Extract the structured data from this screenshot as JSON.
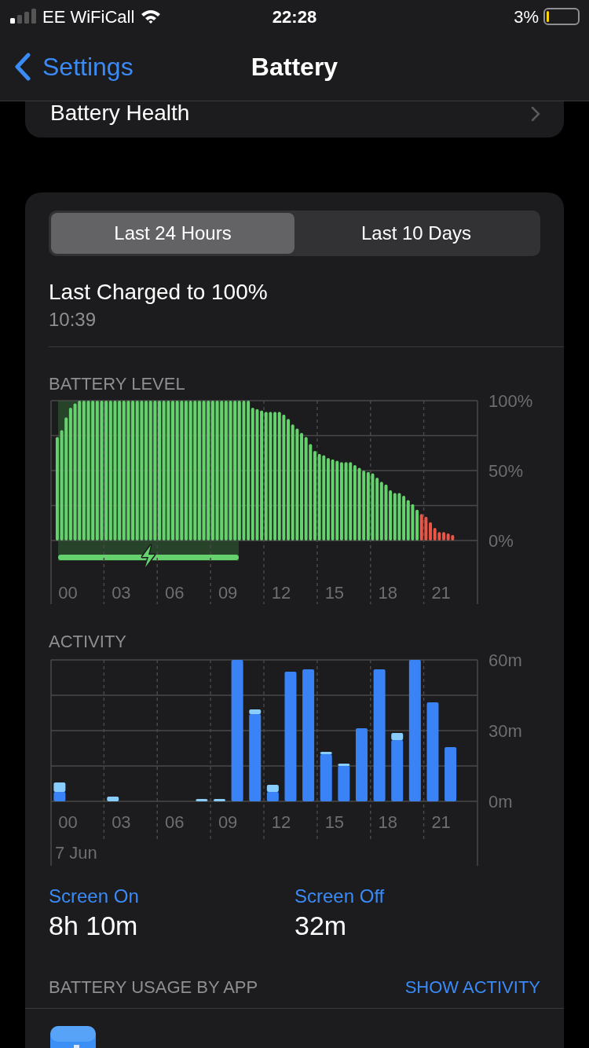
{
  "status_bar": {
    "carrier": "EE WiFiCall",
    "time": "22:28",
    "battery_percent": "3%"
  },
  "nav": {
    "back": "Settings",
    "title": "Battery"
  },
  "health_row": {
    "label": "Battery Health"
  },
  "tabs": [
    {
      "label": "Last 24 Hours",
      "selected": true
    },
    {
      "label": "Last 10 Days",
      "selected": false
    }
  ],
  "last_charged": {
    "title": "Last Charged to 100%",
    "time": "10:39"
  },
  "battery_level": {
    "label": "BATTERY LEVEL",
    "charging": true,
    "chart_data": {
      "type": "bar",
      "xlim": [
        -0.95,
        23.05
      ],
      "ylim": [
        0,
        100
      ],
      "x": [
        -0.6,
        -0.35,
        -0.1,
        0.15,
        0.4,
        0.65,
        0.9,
        1.15,
        1.4,
        1.65,
        1.9,
        2.15,
        2.4,
        2.65,
        2.9,
        3.15,
        3.4,
        3.65,
        3.9,
        4.15,
        4.4,
        4.65,
        4.9,
        5.15,
        5.4,
        5.65,
        5.9,
        6.15,
        6.4,
        6.65,
        6.9,
        7.15,
        7.4,
        7.65,
        7.9,
        8.15,
        8.4,
        8.65,
        8.9,
        9.15,
        9.4,
        9.65,
        9.9,
        10.15,
        10.4,
        10.65,
        10.9,
        11.15,
        11.4,
        11.65,
        11.9,
        12.15,
        12.4,
        12.65,
        12.9,
        13.15,
        13.4,
        13.65,
        13.9,
        14.15,
        14.4,
        14.65,
        14.9,
        15.15,
        15.4,
        15.65,
        15.9,
        16.15,
        16.4,
        16.65,
        16.9,
        17.15,
        17.4,
        17.65,
        17.9,
        18.15,
        18.4,
        18.65,
        18.9,
        19.15,
        19.4,
        19.65,
        19.9,
        20.15,
        20.4,
        20.65,
        20.9,
        21.15,
        21.4,
        21.65
      ],
      "series": [
        {
          "color": "#65d26e",
          "values": [
            74,
            79,
            88,
            95,
            98,
            100,
            100,
            100,
            100,
            100,
            100,
            100,
            100,
            100,
            100,
            100,
            100,
            100,
            100,
            100,
            100,
            100,
            100,
            100,
            100,
            100,
            100,
            100,
            100,
            100,
            100,
            100,
            100,
            100,
            100,
            100,
            100,
            100,
            100,
            100,
            100,
            100,
            100,
            100,
            95,
            94,
            93,
            92,
            92,
            92,
            92,
            90,
            87,
            83,
            80,
            77,
            74,
            69,
            64,
            62,
            61,
            59,
            58,
            57,
            56,
            56,
            56,
            54,
            52,
            50,
            49,
            48,
            45,
            42,
            40,
            36,
            34,
            34,
            32,
            29,
            26,
            22,
            null,
            null,
            null,
            null,
            null,
            null,
            null,
            null
          ]
        },
        {
          "color": "#eb5545",
          "values": [
            null,
            null,
            null,
            null,
            null,
            null,
            null,
            null,
            null,
            null,
            null,
            null,
            null,
            null,
            null,
            null,
            null,
            null,
            null,
            null,
            null,
            null,
            null,
            null,
            null,
            null,
            null,
            null,
            null,
            null,
            null,
            null,
            null,
            null,
            null,
            null,
            null,
            null,
            null,
            null,
            null,
            null,
            null,
            null,
            null,
            null,
            null,
            null,
            null,
            null,
            null,
            null,
            null,
            null,
            null,
            null,
            null,
            null,
            null,
            null,
            null,
            null,
            null,
            null,
            null,
            null,
            null,
            null,
            null,
            null,
            null,
            null,
            null,
            null,
            null,
            null,
            null,
            null,
            null,
            null,
            null,
            null,
            19,
            17,
            13,
            9,
            6,
            6,
            5,
            4
          ]
        }
      ],
      "xticks": [
        {
          "value": 0,
          "label": "00"
        },
        {
          "value": 3,
          "label": "03"
        },
        {
          "value": 6,
          "label": "06"
        },
        {
          "value": 9,
          "label": "09"
        },
        {
          "value": 12,
          "label": "12"
        },
        {
          "value": 15,
          "label": "15"
        },
        {
          "value": 18,
          "label": "18"
        },
        {
          "value": 21,
          "label": "21"
        }
      ],
      "yticks": [
        {
          "value": 0,
          "label": "0%"
        },
        {
          "value": 50,
          "label": "50%"
        },
        {
          "value": 100,
          "label": "100%"
        }
      ]
    }
  },
  "activity": {
    "label": "ACTIVITY",
    "date_label": "7 Jun",
    "chart_data": {
      "type": "bar",
      "stacked": true,
      "xlim": [
        -0.95,
        23.05
      ],
      "ylim": [
        0,
        60
      ],
      "x": [
        -0.47,
        0.53,
        1.53,
        2.53,
        3.53,
        4.53,
        5.53,
        6.53,
        7.53,
        8.53,
        9.53,
        10.53,
        11.53,
        12.53,
        13.53,
        14.53,
        15.53,
        16.53,
        17.53,
        18.53,
        19.53,
        20.53,
        21.53,
        22.53
      ],
      "series": [
        {
          "color": "#3a83f7",
          "values": [
            4,
            0,
            0,
            0,
            0,
            0,
            0,
            0,
            0,
            0,
            60,
            37,
            4,
            55,
            56,
            20,
            15,
            31,
            56,
            26,
            60,
            42,
            23,
            0
          ]
        },
        {
          "color": "#88cdfb",
          "values": [
            4,
            0,
            0,
            2,
            0,
            0,
            0,
            0,
            1,
            1,
            0,
            2,
            3,
            0,
            0,
            1,
            1,
            0,
            0,
            3,
            0,
            0,
            0,
            0
          ]
        }
      ],
      "xticks": [
        {
          "value": 0,
          "label": "00"
        },
        {
          "value": 3,
          "label": "03"
        },
        {
          "value": 6,
          "label": "06"
        },
        {
          "value": 9,
          "label": "09"
        },
        {
          "value": 12,
          "label": "12"
        },
        {
          "value": 15,
          "label": "15"
        },
        {
          "value": 18,
          "label": "18"
        },
        {
          "value": 21,
          "label": "21"
        }
      ],
      "yticks": [
        {
          "value": 0,
          "label": "0m"
        },
        {
          "value": 30,
          "label": "30m"
        },
        {
          "value": 60,
          "label": "60m"
        }
      ]
    }
  },
  "totals": [
    {
      "label": "Screen On",
      "value": "8h 10m"
    },
    {
      "label": "Screen Off",
      "value": "32m"
    }
  ],
  "usage": {
    "title": "BATTERY USAGE BY APP",
    "action": "SHOW ACTIVITY"
  }
}
